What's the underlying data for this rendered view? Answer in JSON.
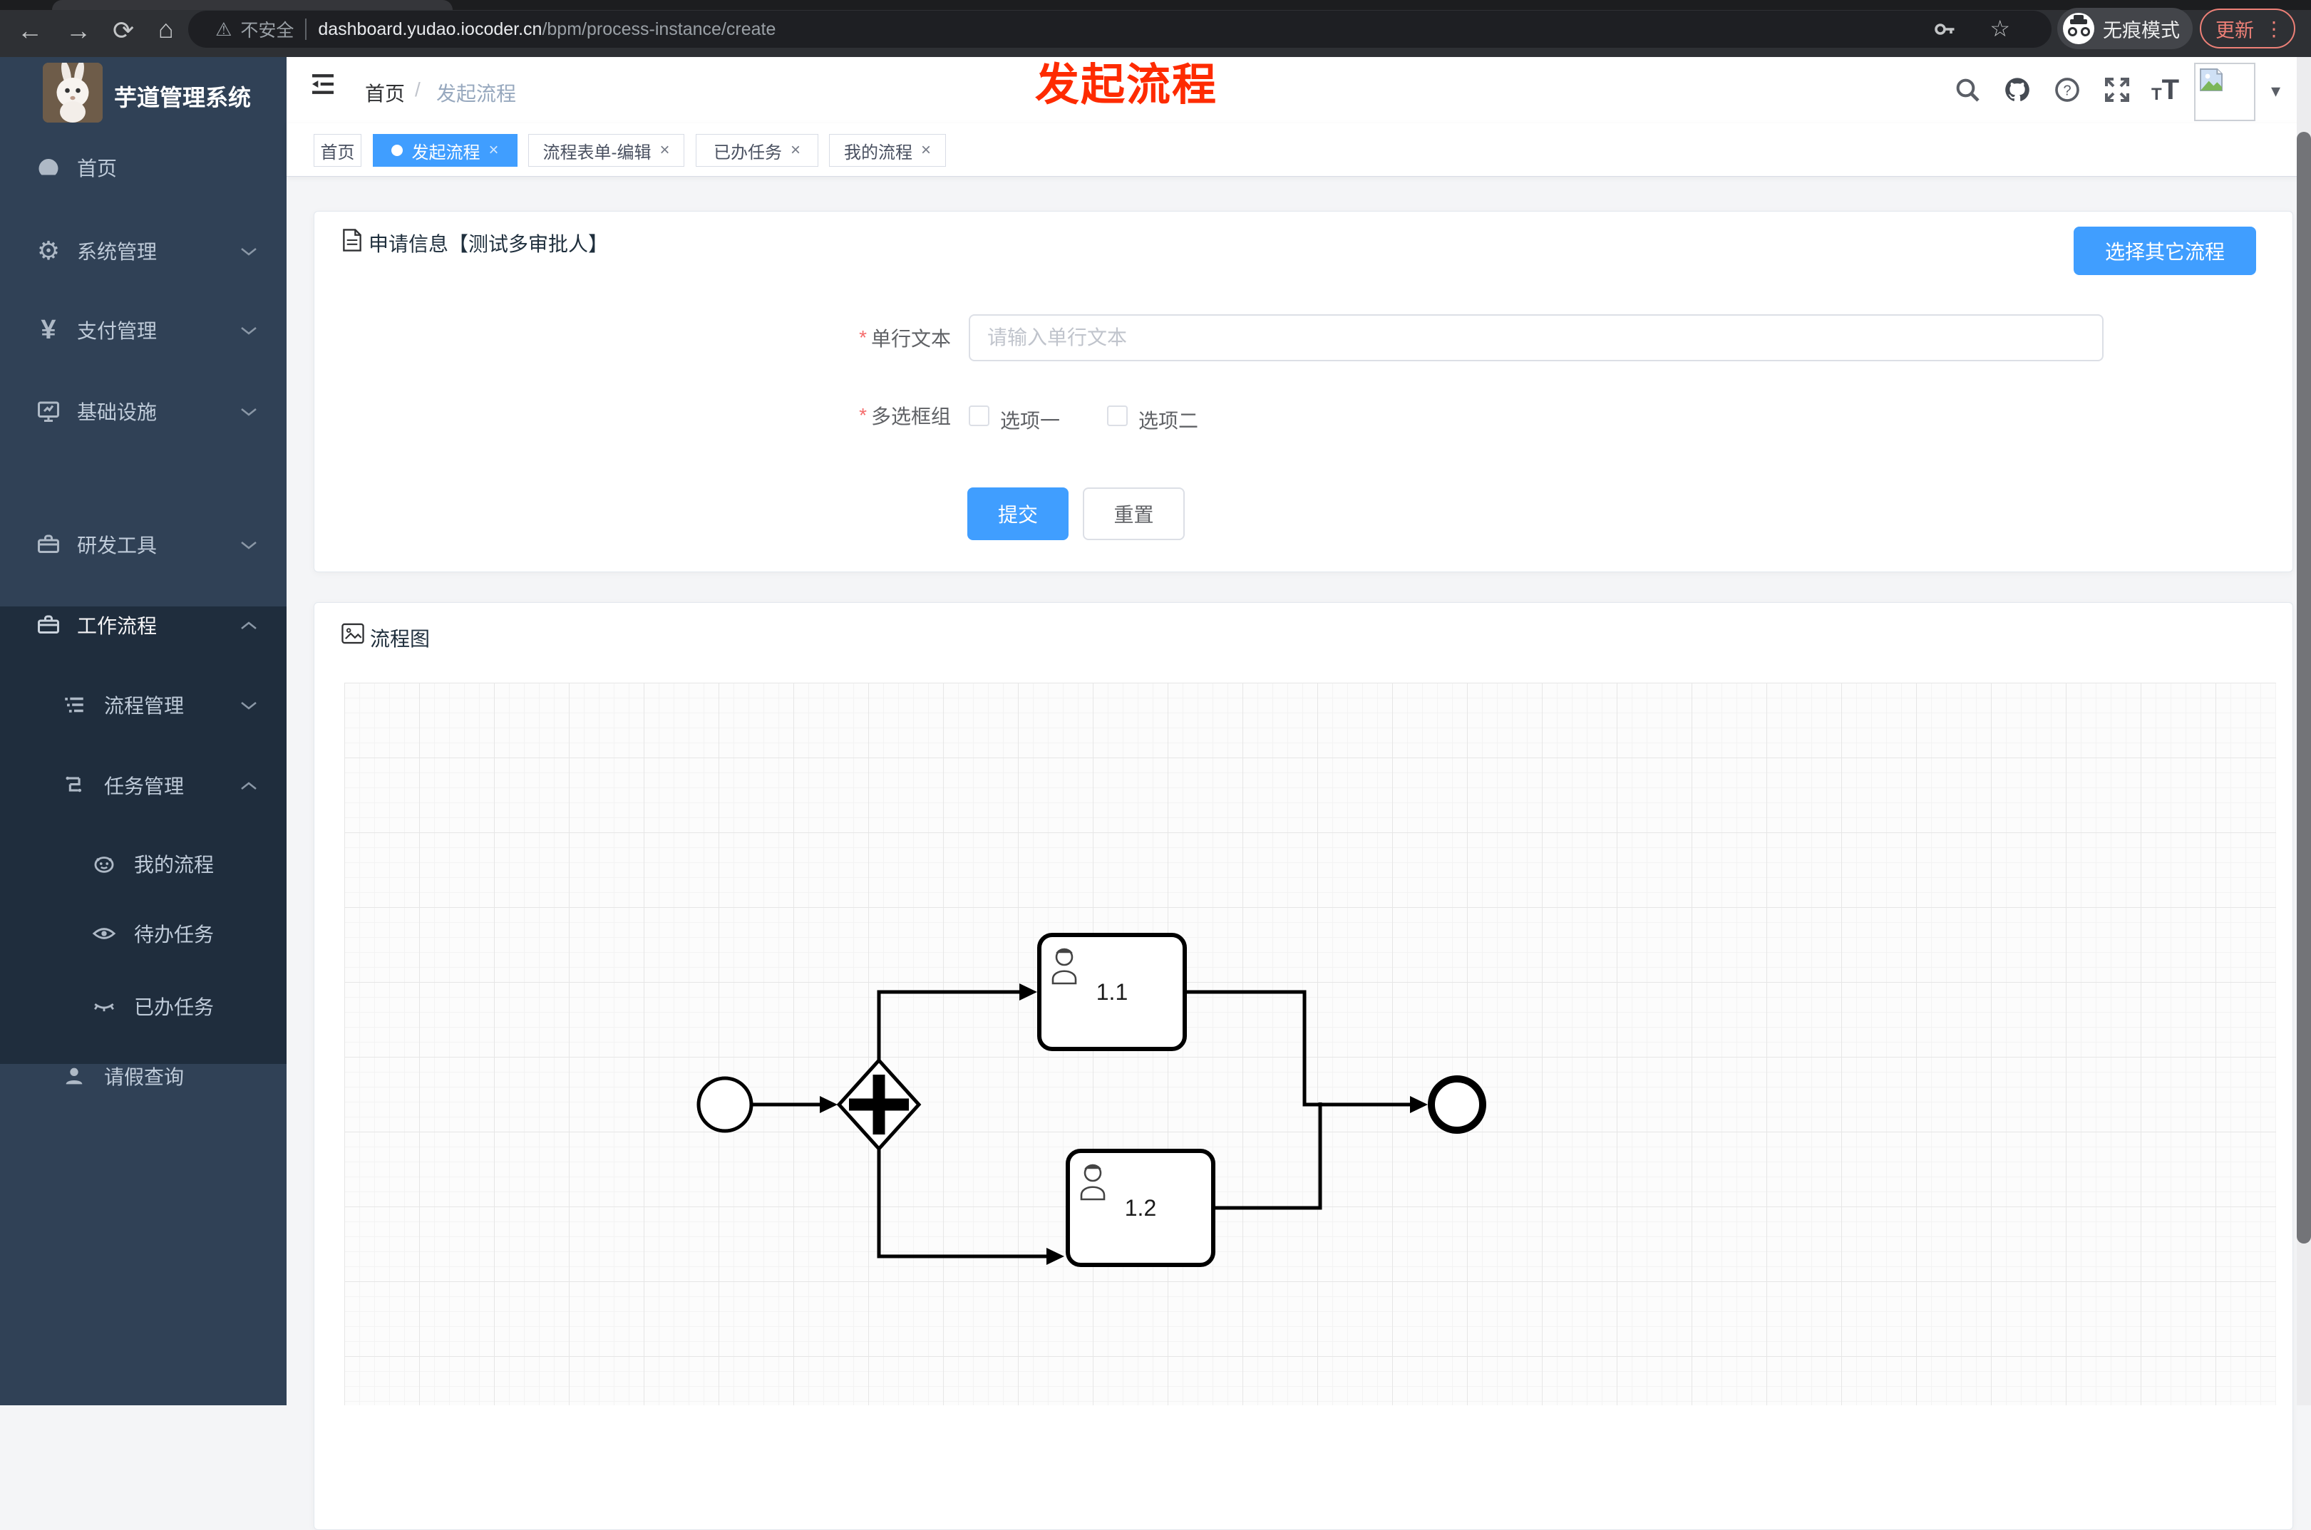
{
  "browser": {
    "security_label": "不安全",
    "url_host": "dashboard.yudao.iocoder.cn",
    "url_path": "/bpm/process-instance/create",
    "incognito_label": "无痕模式",
    "update_label": "更新"
  },
  "icons": {
    "back": "←",
    "forward": "→",
    "reload": "⟳",
    "home": "⌂",
    "warning": "⚠",
    "star": "☆",
    "more_vertical": "⋮",
    "gear": "⚙",
    "yen": "¥",
    "caret_down": "▾",
    "close": "×"
  },
  "sidebar": {
    "title": "芋道管理系统",
    "items": [
      {
        "label": "首页"
      },
      {
        "label": "系统管理"
      },
      {
        "label": "支付管理"
      },
      {
        "label": "基础设施"
      },
      {
        "label": "研发工具"
      },
      {
        "label": "工作流程"
      },
      {
        "label": "流程管理"
      },
      {
        "label": "任务管理"
      },
      {
        "label": "我的流程"
      },
      {
        "label": "待办任务"
      },
      {
        "label": "已办任务"
      },
      {
        "label": "请假查询"
      }
    ]
  },
  "header": {
    "breadcrumb": {
      "home": "首页",
      "separator": "/",
      "current": "发起流程"
    }
  },
  "tabs": [
    {
      "label": "首页"
    },
    {
      "label": "发起流程"
    },
    {
      "label": "流程表单-编辑"
    },
    {
      "label": "已办任务"
    },
    {
      "label": "我的流程"
    }
  ],
  "annotation": {
    "text": "发起流程"
  },
  "apply_card": {
    "title": "申请信息【测试多审批人】",
    "select_other_button": "选择其它流程",
    "fields": {
      "text": {
        "label": "单行文本",
        "placeholder": "请输入单行文本",
        "required": true,
        "value": ""
      },
      "checkbox_group": {
        "label": "多选框组",
        "required": true,
        "options": [
          {
            "label": "选项一",
            "checked": false
          },
          {
            "label": "选项二",
            "checked": false
          }
        ]
      }
    },
    "submit_label": "提交",
    "reset_label": "重置"
  },
  "diagram_card": {
    "title": "流程图",
    "nodes": {
      "start_event": "",
      "parallel_gateway": "+",
      "task1_label": "1.1",
      "task2_label": "1.2",
      "end_event": ""
    }
  },
  "colors": {
    "primary": "#409eff",
    "annotation_red": "#fe2b00",
    "sidebar_bg": "#304156",
    "sidebar_submenu_bg": "#1f2d3d",
    "tab_border": "#d8dce5"
  }
}
